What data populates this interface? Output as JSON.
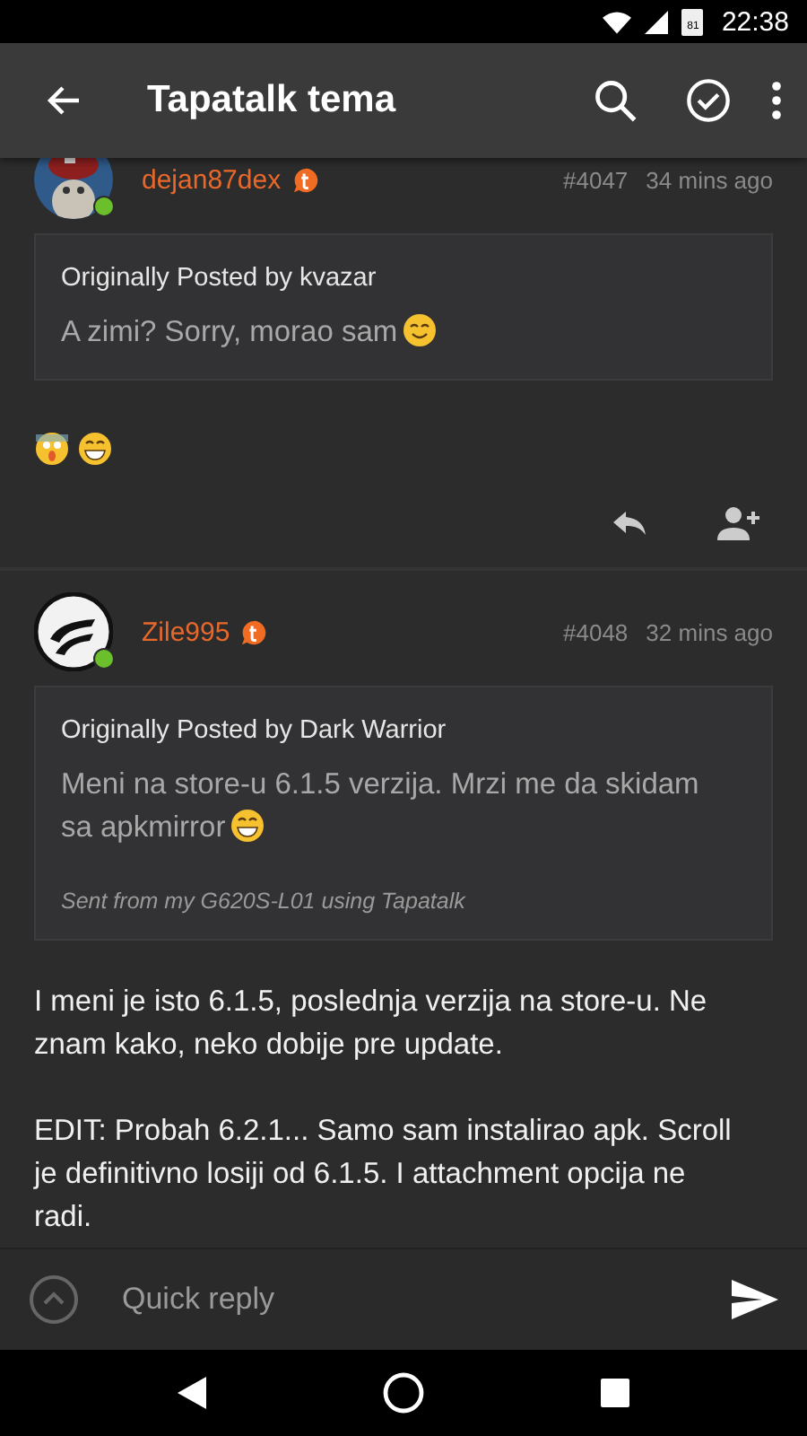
{
  "status_bar": {
    "time": "22:38",
    "battery": "81"
  },
  "app_bar": {
    "title": "Tapatalk tema"
  },
  "posts": [
    {
      "author": "dejan87dex",
      "online": true,
      "avatar": {
        "kind": "picture"
      },
      "number": "#4047",
      "time": "34 mins ago",
      "quote": {
        "header": "Originally Posted by kvazar",
        "text": "A zimi? Sorry, morao sam",
        "ends_with_emoji": true
      },
      "body": [
        {
          "kind": "emoji_row"
        }
      ],
      "actions": true
    },
    {
      "author": "Zile995",
      "online": true,
      "avatar": {
        "kind": "logo"
      },
      "number": "#4048",
      "time": "32 mins ago",
      "quote": {
        "header": "Originally Posted by Dark Warrior",
        "text": "Meni na store-u 6.1.5 verzija. Mrzi me da skidam sa apkmirror",
        "ends_with_emoji": true,
        "signature": "Sent from my G620S-L01 using Tapatalk"
      },
      "body": [
        {
          "kind": "text",
          "text": "I meni je isto 6.1.5, poslednja verzija na store-u. Ne znam kako, neko dobije pre update."
        },
        {
          "kind": "text",
          "text": "EDIT: Probah 6.2.1... Samo sam instalirao apk. Scroll je definitivno losiji od 6.1.5. I attachment opcija ne radi."
        }
      ],
      "actions": false
    }
  ],
  "quick_reply": {
    "placeholder": "Quick reply"
  }
}
